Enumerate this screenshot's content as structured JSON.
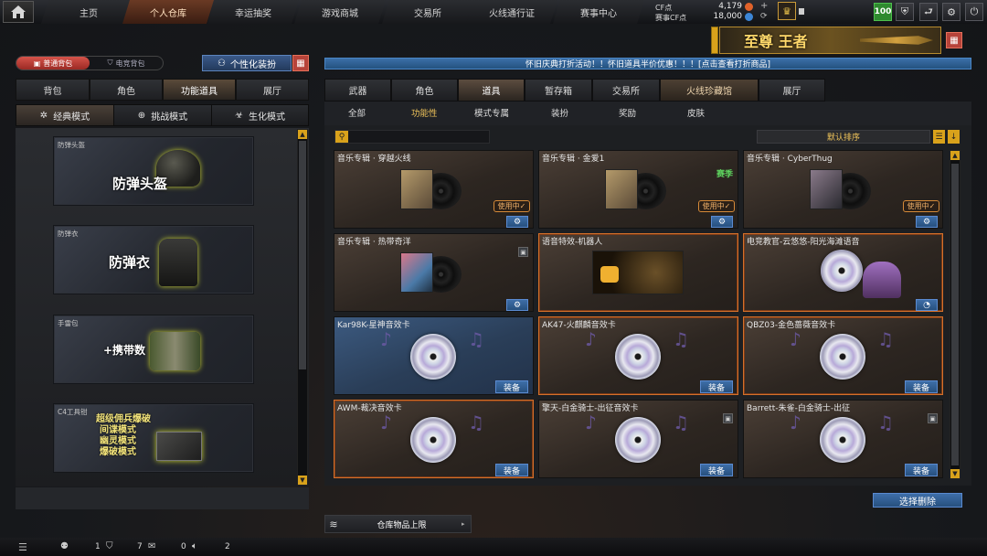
{
  "topnav": {
    "tabs": [
      "主页",
      "个人仓库",
      "幸运抽奖",
      "游戏商城",
      "交易所",
      "火线通行证",
      "赛事中心"
    ],
    "active_index": 1,
    "cf_label": "CF点",
    "cf_value": "4,179",
    "event_cf_label": "赛事CF点",
    "event_cf_value": "18,000",
    "level": "100"
  },
  "rank_banner": {
    "text": "至尊 王者"
  },
  "left": {
    "bag_switch": {
      "normal": "普通背包",
      "esports": "电竞背包"
    },
    "customize_label": "个性化装扮",
    "tabs": [
      "背包",
      "角色",
      "功能道具",
      "展厅"
    ],
    "active_tab": 2,
    "modes": [
      "经典模式",
      "挑战模式",
      "生化模式"
    ],
    "active_mode": 0,
    "cards": [
      {
        "caption": "防弹头盔",
        "big": "防弹头盔"
      },
      {
        "caption": "防弹衣",
        "big": "防弹衣"
      },
      {
        "caption": "手雷包",
        "big": "+携带数"
      },
      {
        "caption": "C4工具钳",
        "lines": [
          "超级佣兵爆破",
          "间谍模式",
          "幽灵模式",
          "爆破模式"
        ]
      }
    ]
  },
  "right": {
    "banner": "怀旧庆典打折活动！！怀旧道具半价优惠！！！[点击查看打折商品]",
    "tabs": [
      "武器",
      "角色",
      "道具",
      "暂存箱",
      "交易所",
      "火线珍藏馆",
      "展厅"
    ],
    "active_tab": 2,
    "subtabs": [
      "全部",
      "功能性",
      "模式专属",
      "装扮",
      "奖励",
      "皮肤"
    ],
    "active_subtab": 1,
    "search_placeholder": "",
    "sort_label": "默认排序",
    "items": [
      {
        "name": "音乐专辑 · 穿越火线",
        "type": "album",
        "inuse": "使用中✓",
        "action": "gear",
        "style": "plain"
      },
      {
        "name": "音乐专辑 · 金爱1",
        "type": "album",
        "inuse": "使用中✓",
        "badge": "赛季",
        "action": "gear",
        "style": "plain"
      },
      {
        "name": "音乐专辑 · CyberThug",
        "type": "album",
        "inuse": "使用中✓",
        "action": "gear",
        "style": "plain"
      },
      {
        "name": "音乐专辑 · 热带奇洋",
        "type": "album",
        "lock": true,
        "action": "gear",
        "style": "plain"
      },
      {
        "name": "语音特效-机器人",
        "type": "voice",
        "style": "orange"
      },
      {
        "name": "电竞教官-云悠悠-阳光海滩语音",
        "type": "coach",
        "action": "round",
        "style": "orange"
      },
      {
        "name": "Kar98K-星神音效卡",
        "type": "disc",
        "action": "equip",
        "style": "blue"
      },
      {
        "name": "AK47-火麒麟音效卡",
        "type": "disc",
        "action": "equip",
        "style": "orange"
      },
      {
        "name": "QBZ03-金色蔷薇音效卡",
        "type": "disc",
        "action": "equip",
        "style": "orange"
      },
      {
        "name": "AWM-裁决音效卡",
        "type": "disc",
        "action": "equip",
        "style": "orange"
      },
      {
        "name": "擎天-白金骑士-出征音效卡",
        "type": "disc",
        "lock": true,
        "action": "equip",
        "style": "plain"
      },
      {
        "name": "Barrett-朱雀-白金骑士-出征",
        "type": "disc",
        "lock": true,
        "action": "equip",
        "style": "plain"
      }
    ],
    "equip_label": "装备",
    "batch_delete": "选择删除",
    "capacity_label": "仓库物品上限"
  },
  "statusbar": {
    "count1": "1",
    "count2": "7",
    "count3": "0",
    "count4": "2"
  }
}
